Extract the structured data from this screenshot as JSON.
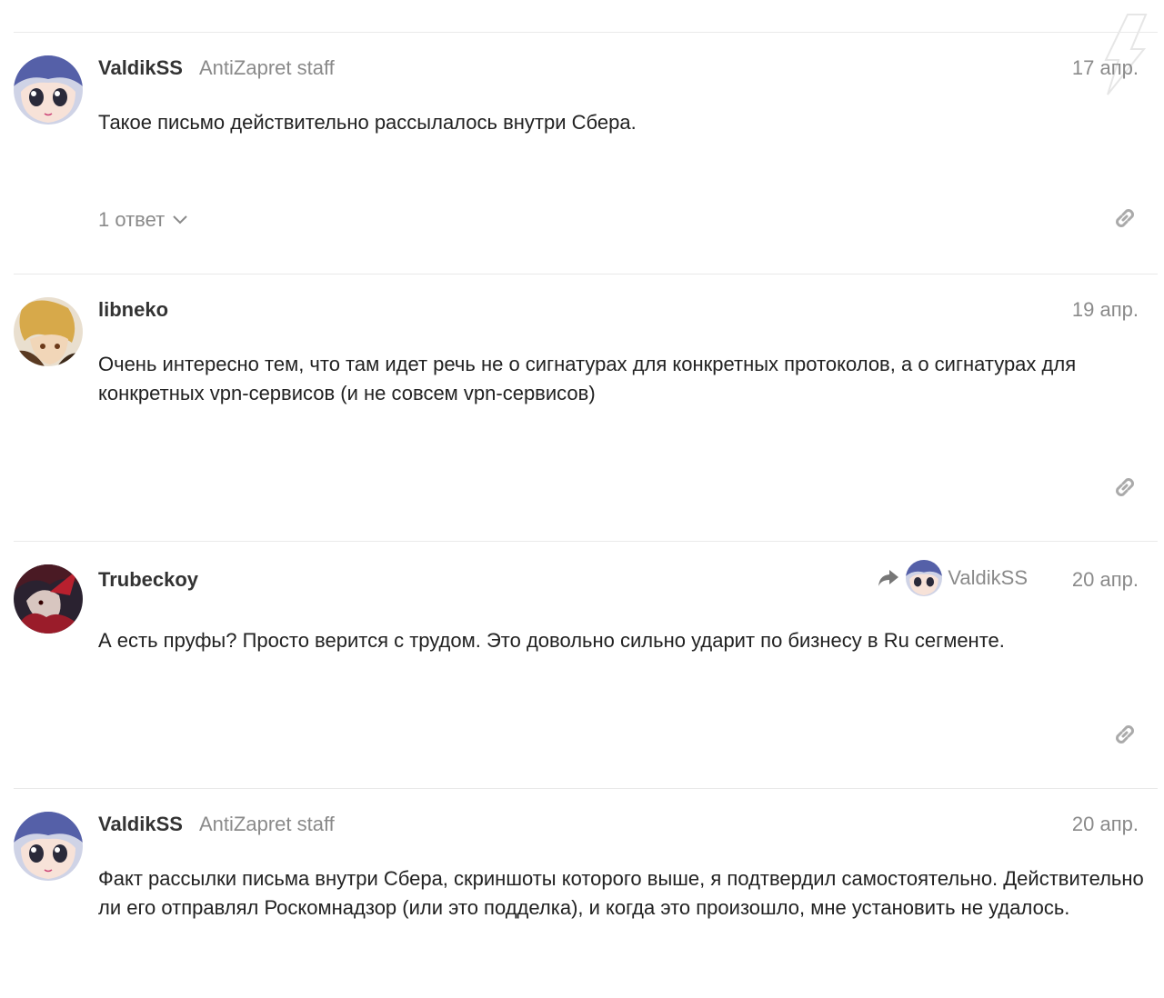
{
  "posts": [
    {
      "username": "ValdikSS",
      "user_title": "AntiZapret staff",
      "date": "17 апр.",
      "body": [
        "Такое письмо действительно рассылалось внутри Сбера."
      ],
      "replies_label": "1 ответ",
      "avatar": "anime-girl-blue-hair"
    },
    {
      "username": "libneko",
      "user_title": "",
      "date": "19 апр.",
      "body": [
        "Очень интересно тем, что там идет речь не о сигнатурах для конкретных протоколов, а о сигнатурах для конкретных vpn-сервисов (и не совсем vpn-сервисов)"
      ],
      "avatar": "anime-character-blonde"
    },
    {
      "username": "Trubeckoy",
      "user_title": "",
      "date": "20 апр.",
      "reply_to": "ValdikSS",
      "body": [
        "А есть пруфы? Просто верится с трудом. Это довольно сильно ударит по бизнесу в Ru сегменте."
      ],
      "avatar": "dark-red-character"
    },
    {
      "username": "ValdikSS",
      "user_title": "AntiZapret staff",
      "date": "20 апр.",
      "body": [
        "Факт рассылки письма внутри Сбера, скриншоты которого выше, я подтвердил самостоятельно. Действительно ли его отправлял Роскомнадзор (или это подделка), и когда это произошло, мне установить не удалось."
      ],
      "avatar": "anime-girl-blue-hair"
    }
  ],
  "icons": {
    "link": "link-icon",
    "reply_arrow": "share-arrow-icon",
    "chevron": "chevron-down-icon"
  },
  "colors": {
    "muted": "#8a8a8a",
    "divider": "#e9e9e9",
    "text": "#222222"
  }
}
